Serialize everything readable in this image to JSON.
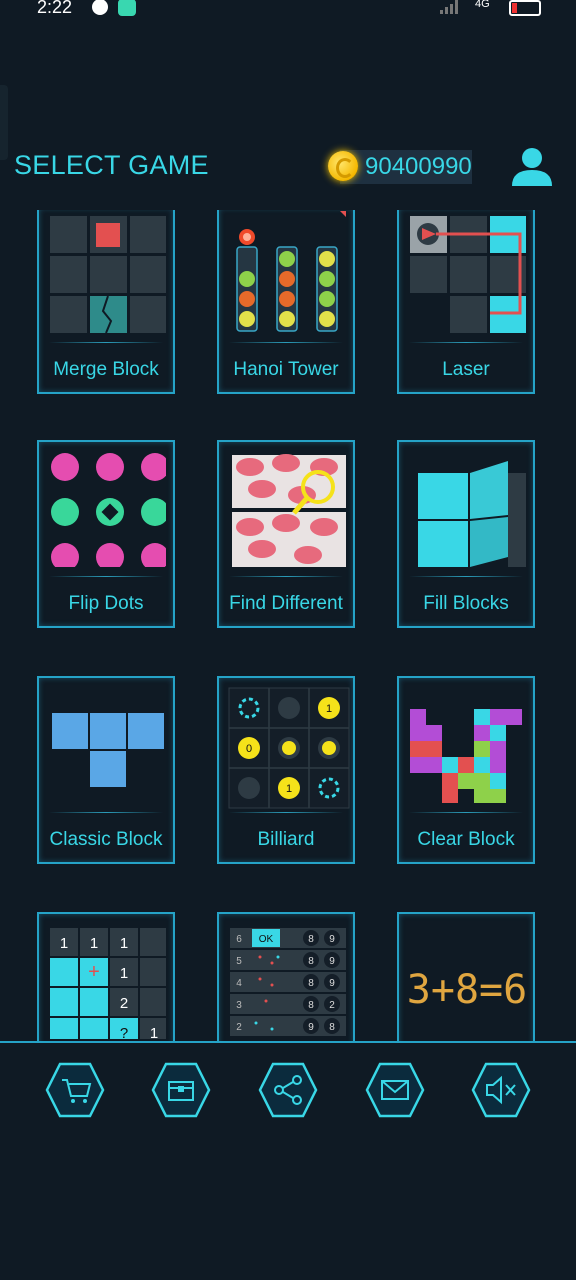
{
  "status_bar": {
    "time": "2:22",
    "network": "4G",
    "battery_color": "#e33333"
  },
  "header": {
    "title": "SELECT GAME",
    "coins": "90400990",
    "profile_icon": "user-icon"
  },
  "games": [
    {
      "label": "Merge Block"
    },
    {
      "label": "Hanoi Tower"
    },
    {
      "label": "Laser"
    },
    {
      "label": "Flip Dots"
    },
    {
      "label": "Find Different"
    },
    {
      "label": "Fill Blocks"
    },
    {
      "label": "Classic Block"
    },
    {
      "label": "Billiard"
    },
    {
      "label": "Clear Block"
    },
    {
      "label": ""
    },
    {
      "label": ""
    },
    {
      "label": ""
    }
  ],
  "thumbs": {
    "billiard": {
      "top_right": "1",
      "mid_left": "0",
      "bottom_mid": "1"
    },
    "nonogram": {
      "r1": [
        "1",
        "1",
        "1"
      ],
      "r2": "1",
      "r3": "2",
      "r4_q": "?",
      "r4": "1"
    },
    "dice": {
      "rows": [
        "6",
        "5",
        "4",
        "3",
        "2"
      ],
      "ok": "OK",
      "col1": [
        "8",
        "8",
        "8",
        "8",
        "9"
      ],
      "col2": [
        "9",
        "9",
        "9",
        "2",
        "8"
      ]
    },
    "matchstick": "3+8=6"
  },
  "toolbar": [
    {
      "icon": "cart-icon"
    },
    {
      "icon": "chest-icon"
    },
    {
      "icon": "share-icon"
    },
    {
      "icon": "mail-icon"
    },
    {
      "icon": "sound-off-icon"
    }
  ],
  "colors": {
    "accent": "#39d7e6",
    "frame": "#25a3c7",
    "background": "#0f1a24",
    "coin": "#f5c400"
  }
}
